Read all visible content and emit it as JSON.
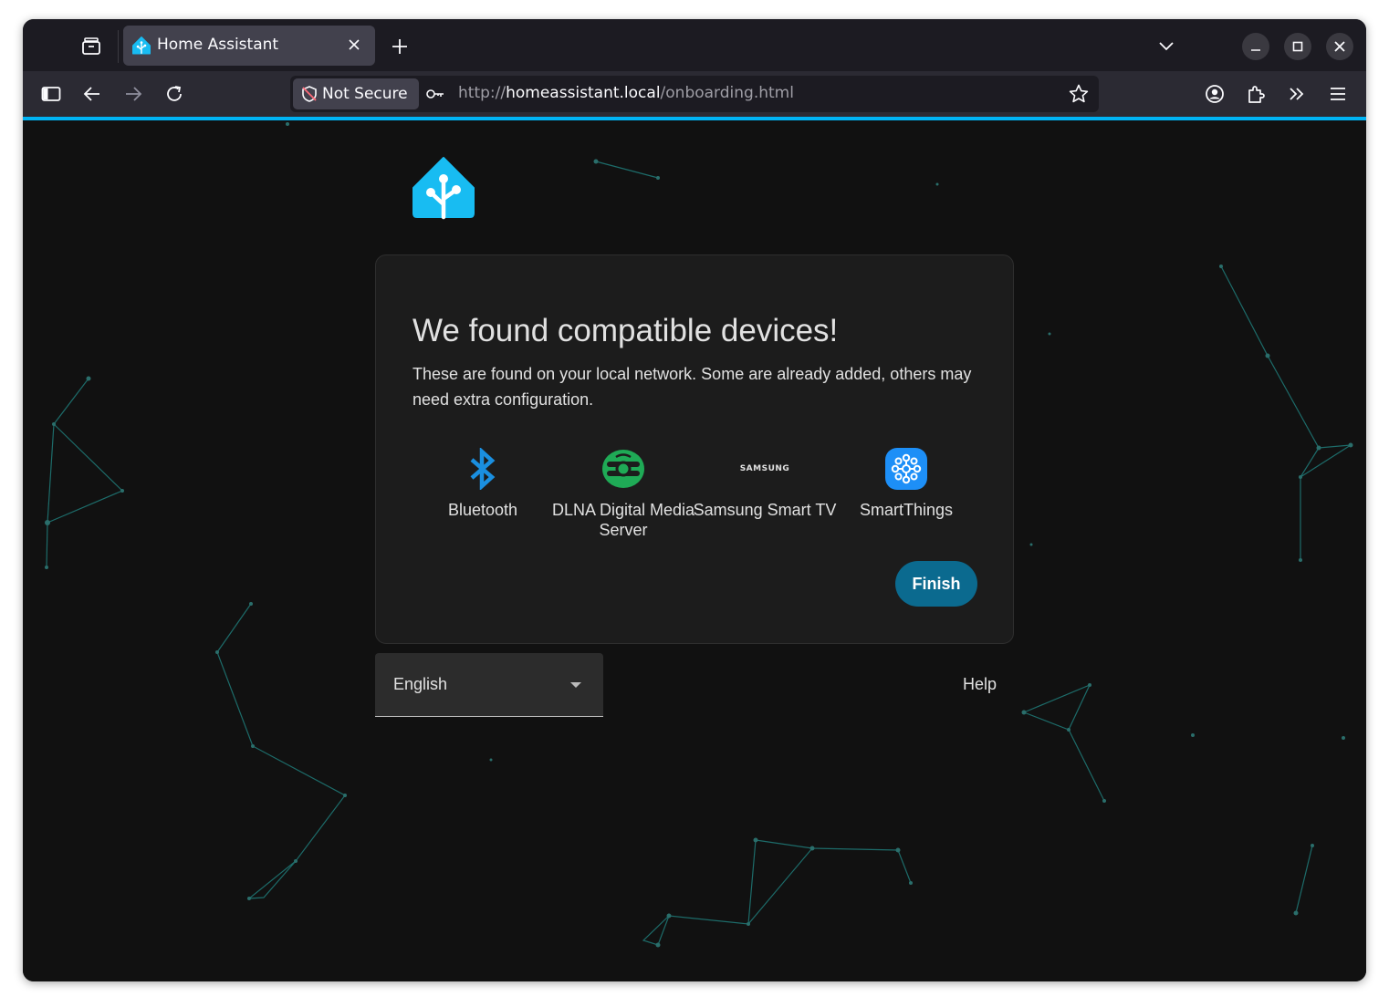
{
  "browser": {
    "tab_title": "Home Assistant",
    "security_label": "Not Secure",
    "url_scheme": "http://",
    "url_host": "homeassistant.local",
    "url_path": "/onboarding.html",
    "accent_color": "#00b3f4"
  },
  "card": {
    "title": "We found compatible devices!",
    "description": "These are found on your local network. Some are already added, others may need extra configuration.",
    "devices": [
      {
        "name": "Bluetooth",
        "icon": "bluetooth-icon"
      },
      {
        "name": "DLNA Digital Media Server",
        "icon": "dlna-icon"
      },
      {
        "name": "Samsung Smart TV",
        "icon": "samsung-logo",
        "logo_text": "SAMSUNG"
      },
      {
        "name": "SmartThings",
        "icon": "smartthings-icon"
      }
    ],
    "finish_label": "Finish",
    "finish_color": "#0b6a8f"
  },
  "footer": {
    "language": "English",
    "help_label": "Help"
  }
}
